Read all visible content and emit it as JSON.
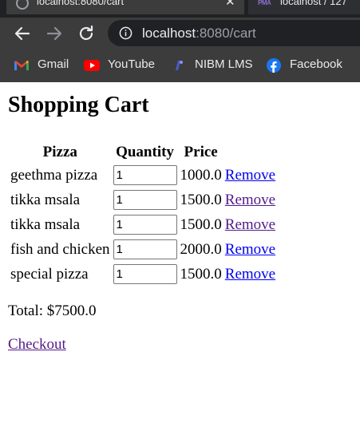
{
  "browser": {
    "tabs": [
      {
        "title": "localhost:8080/cart",
        "active": true
      },
      {
        "title": "localhost / 127",
        "active": false,
        "favicon_text": "PMA"
      }
    ],
    "url_host": "localhost",
    "url_rest": ":8080/cart",
    "bookmarks": [
      {
        "label": "Gmail",
        "icon": "gmail-icon"
      },
      {
        "label": "YouTube",
        "icon": "youtube-icon"
      },
      {
        "label": "NIBM LMS",
        "icon": "nibm-lms-icon"
      },
      {
        "label": "Facebook",
        "icon": "facebook-icon"
      }
    ],
    "colors": {
      "chrome": "#3c3c3c",
      "omnibox": "#202124",
      "text": "#e8eaed"
    }
  },
  "page": {
    "title": "Shopping Cart",
    "table": {
      "headers": [
        "Pizza",
        "Quantity",
        "Price"
      ],
      "rows": [
        {
          "name": "geethma pizza",
          "quantity": "1",
          "price": "1000.0",
          "action": "Remove",
          "visited": false
        },
        {
          "name": "tikka msala",
          "quantity": "1",
          "price": "1500.0",
          "action": "Remove",
          "visited": true
        },
        {
          "name": "tikka msala",
          "quantity": "1",
          "price": "1500.0",
          "action": "Remove",
          "visited": true
        },
        {
          "name": "fish and chicken",
          "quantity": "1",
          "price": "2000.0",
          "action": "Remove",
          "visited": false
        },
        {
          "name": "special pizza",
          "quantity": "1",
          "price": "1500.0",
          "action": "Remove",
          "visited": false
        }
      ]
    },
    "total": "Total: $7500.0",
    "checkout": "Checkout",
    "colors": {
      "link": "#0000ee",
      "visited_link": "#551a8b"
    }
  }
}
